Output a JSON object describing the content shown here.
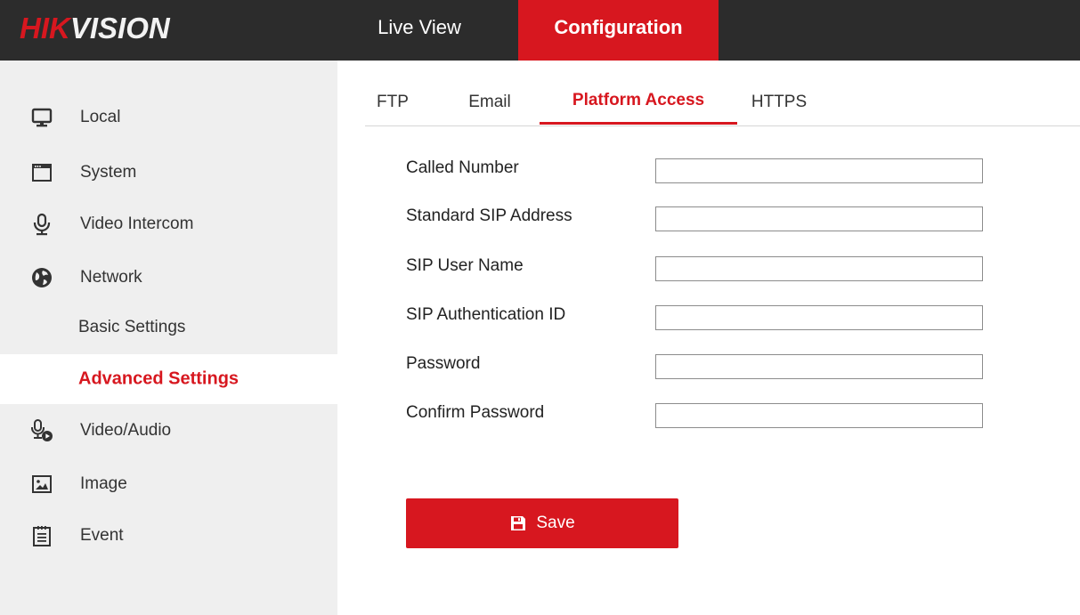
{
  "brand": {
    "logo_part1": "HIK",
    "logo_part2": "VISION"
  },
  "topnav": {
    "live_view": "Live View",
    "configuration": "Configuration"
  },
  "sidebar": {
    "items": [
      {
        "label": "Local",
        "icon": "monitor-icon"
      },
      {
        "label": "System",
        "icon": "window-icon"
      },
      {
        "label": "Video Intercom",
        "icon": "microphone-icon"
      },
      {
        "label": "Network",
        "icon": "globe-icon"
      },
      {
        "label": "Basic Settings"
      },
      {
        "label": "Advanced Settings",
        "active": true
      },
      {
        "label": "Video/Audio",
        "icon": "mic-play-icon"
      },
      {
        "label": "Image",
        "icon": "image-icon"
      },
      {
        "label": "Event",
        "icon": "calendar-list-icon"
      }
    ]
  },
  "tabs": {
    "ftp": "FTP",
    "email": "Email",
    "platform_access": "Platform Access",
    "https": "HTTPS"
  },
  "form": {
    "fields": [
      {
        "label": "Called Number",
        "value": ""
      },
      {
        "label": "Standard SIP Address",
        "value": ""
      },
      {
        "label": "SIP User Name",
        "value": ""
      },
      {
        "label": "SIP Authentication ID",
        "value": ""
      },
      {
        "label": "Password",
        "value": ""
      },
      {
        "label": "Confirm Password",
        "value": ""
      }
    ]
  },
  "save_button": {
    "label": "Save",
    "icon": "floppy-disk-icon"
  },
  "colors": {
    "accent": "#d7171f",
    "topbar": "#2c2c2c",
    "sidebar_bg": "#efefef"
  }
}
